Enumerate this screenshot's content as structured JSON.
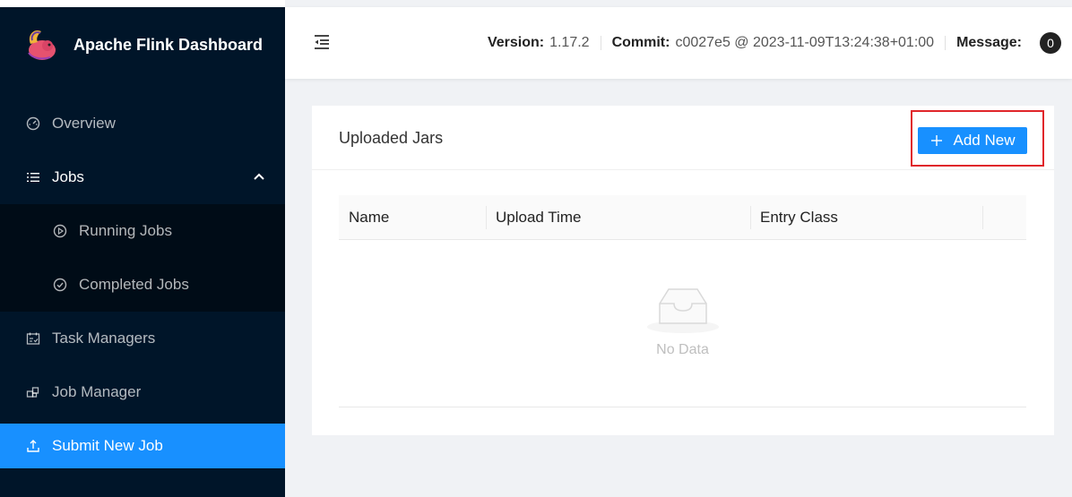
{
  "app": {
    "title": "Apache Flink Dashboard"
  },
  "sidebar": {
    "items": [
      {
        "label": "Overview",
        "icon": "dashboard-icon"
      },
      {
        "label": "Jobs",
        "icon": "list-icon"
      },
      {
        "label": "Running Jobs",
        "icon": "play-circle-icon"
      },
      {
        "label": "Completed Jobs",
        "icon": "check-circle-icon"
      },
      {
        "label": "Task Managers",
        "icon": "schedule-icon"
      },
      {
        "label": "Job Manager",
        "icon": "build-icon"
      },
      {
        "label": "Submit New Job",
        "icon": "upload-icon"
      }
    ],
    "active": "Submit New Job"
  },
  "header": {
    "version_label": "Version:",
    "version_value": "1.17.2",
    "commit_label": "Commit:",
    "commit_value": "c0027e5 @ 2023-11-09T13:24:38+01:00",
    "message_label": "Message:",
    "message_count": "0"
  },
  "card": {
    "title": "Uploaded Jars",
    "add_button_label": "Add New",
    "columns": [
      "Name",
      "Upload Time",
      "Entry Class"
    ],
    "empty_text": "No Data"
  },
  "colors": {
    "sidebar_bg": "#001529",
    "submenu_bg": "#000c17",
    "primary": "#1890ff",
    "highlight": "#e0262a"
  }
}
